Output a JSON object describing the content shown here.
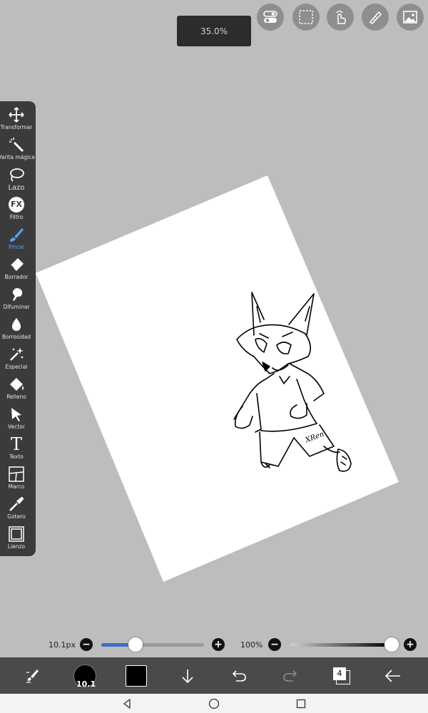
{
  "zoom": {
    "label": "35.0%"
  },
  "top_buttons": [
    {
      "icon": "toggle-icon"
    },
    {
      "icon": "selection-icon"
    },
    {
      "icon": "hand-touch-icon"
    },
    {
      "icon": "ruler-pen-icon"
    },
    {
      "icon": "image-icon"
    }
  ],
  "tools": [
    {
      "label": "Transformar",
      "icon": "move-icon"
    },
    {
      "label": "Varita mágica",
      "icon": "magic-wand-icon"
    },
    {
      "label": "Lazo",
      "icon": "lasso-icon"
    },
    {
      "label": "Filtro",
      "icon": "fx-icon"
    },
    {
      "label": "Pincel",
      "icon": "brush-icon",
      "active": true
    },
    {
      "label": "Borrador",
      "icon": "eraser-icon"
    },
    {
      "label": "Difuminar",
      "icon": "smudge-icon"
    },
    {
      "label": "Borrosidad",
      "icon": "blur-drop-icon"
    },
    {
      "label": "Especial",
      "icon": "sparkle-icon"
    },
    {
      "label": "Relleno",
      "icon": "fill-bucket-icon"
    },
    {
      "label": "Vector",
      "icon": "cursor-arrow-icon"
    },
    {
      "label": "Texto",
      "icon": "text-icon"
    },
    {
      "label": "Marco",
      "icon": "frame-icon"
    },
    {
      "label": "Gotero",
      "icon": "eyedropper-icon"
    },
    {
      "label": "Lienzo",
      "icon": "canvas-icon"
    }
  ],
  "fx_glyph": "FX",
  "text_glyph": "T",
  "sliders": {
    "brush_size": {
      "label": "10.1px",
      "fraction": 0.33
    },
    "opacity": {
      "label": "100%",
      "fraction": 1.0
    },
    "minus": "−",
    "plus": "+"
  },
  "bottom_bar": {
    "brush_size_badge": "10.1",
    "color": "#000000",
    "layers_count": "4",
    "items": [
      "brush-settings-icon",
      "brush-size-indicator",
      "color-swatch",
      "download-icon",
      "undo-icon",
      "redo-icon",
      "layers-icon",
      "back-arrow-icon"
    ]
  },
  "nav": [
    "back-nav-icon",
    "home-nav-icon",
    "recents-nav-icon"
  ],
  "colors": {
    "background": "#bdbdbd",
    "toolbar": "#3b3b3b",
    "accent": "#5aa0ff",
    "slider_fill": "#3b6fc6"
  },
  "signature": "XRen"
}
